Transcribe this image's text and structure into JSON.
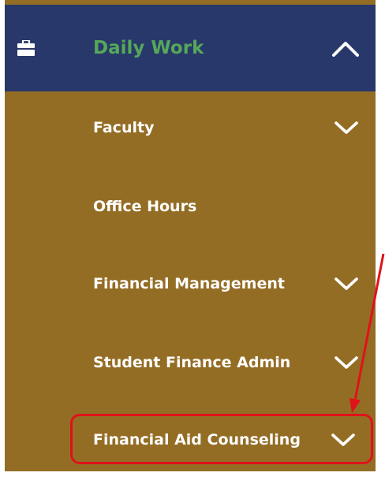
{
  "menu": {
    "header": {
      "title": "Daily Work",
      "icon": "briefcase-icon",
      "expanded": true
    },
    "items": [
      {
        "label": "Faculty",
        "has_submenu": true
      },
      {
        "label": "Office Hours",
        "has_submenu": false
      },
      {
        "label": "Financial Management",
        "has_submenu": true
      },
      {
        "label": "Student Finance Admin",
        "has_submenu": true
      },
      {
        "label": "Financial Aid Counseling",
        "has_submenu": true
      }
    ]
  },
  "colors": {
    "header_bg": "#29386a",
    "header_title": "#55a85a",
    "panel_bg": "#946d25",
    "item_text": "#ffffff",
    "annotation": "#e0121a"
  }
}
